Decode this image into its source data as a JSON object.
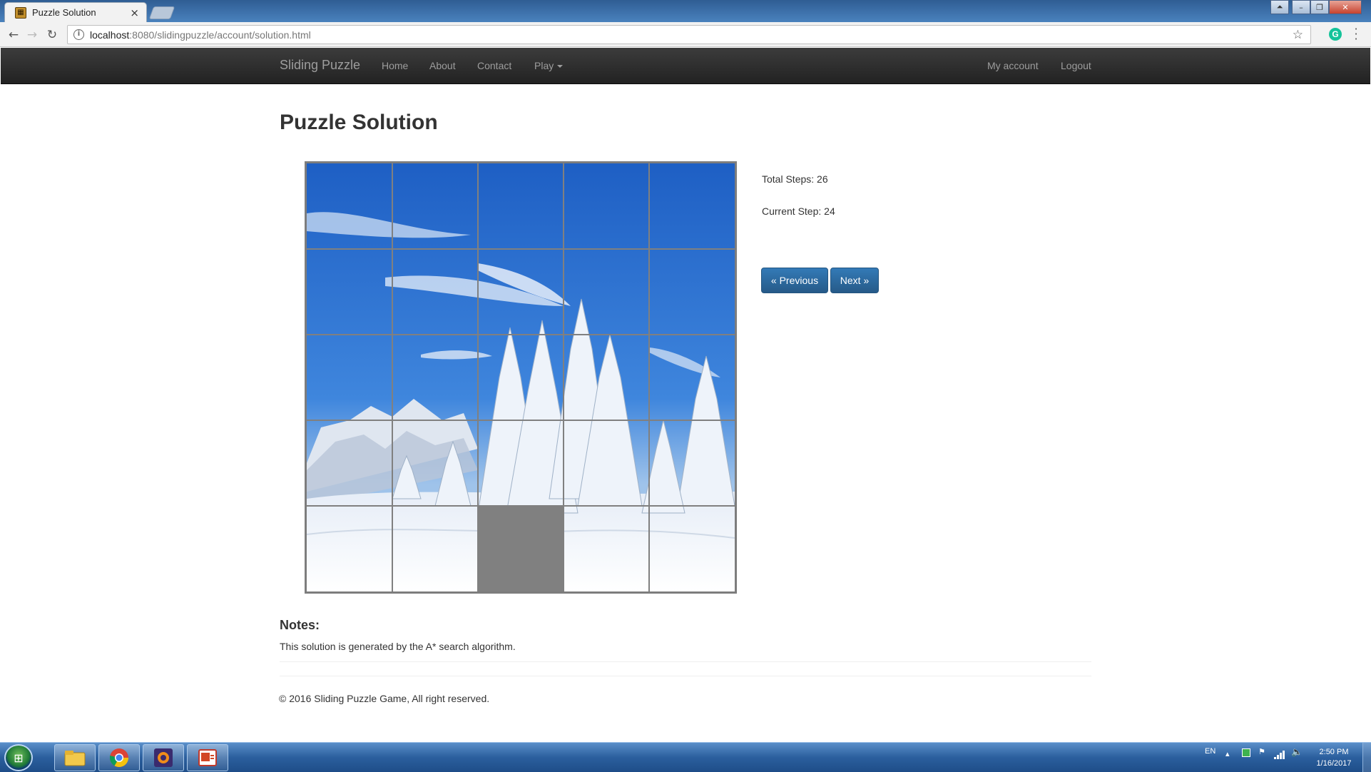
{
  "browser": {
    "tab_title": "Puzzle Solution",
    "tab_close": "×",
    "url_host": "localhost",
    "url_rest": ":8080/slidingpuzzle/account/solution.html"
  },
  "navbar": {
    "brand": "Sliding Puzzle",
    "links": [
      "Home",
      "About",
      "Contact",
      "Play"
    ],
    "right_links": [
      "My account",
      "Logout"
    ]
  },
  "page": {
    "title": "Puzzle Solution",
    "total_steps_label": "Total Steps: 26",
    "current_step_label": "Current Step: 24",
    "prev_button": "« Previous",
    "next_button": "Next »",
    "notes_heading": "Notes:",
    "notes_text": "This solution is generated by the A* search algorithm.",
    "footer": "© 2016 Sliding Puzzle Game, All right reserved."
  },
  "puzzle": {
    "grid_size": 5,
    "empty_tile": {
      "row": 5,
      "col": 3
    },
    "colors": {
      "empty": "#808080",
      "grid_line": "#808080",
      "sky": "#2c6fcf",
      "snow": "#f3f6fb"
    }
  },
  "taskbar": {
    "apps": [
      "file-explorer",
      "chrome",
      "java-ide",
      "powerpoint"
    ],
    "lang": "EN",
    "time": "2:50 PM",
    "date": "1/16/2017"
  },
  "icons": [
    "back-icon",
    "forward-icon",
    "reload-icon",
    "info-icon",
    "star-icon",
    "grammarly-icon",
    "menu-icon",
    "start-orb-icon"
  ]
}
